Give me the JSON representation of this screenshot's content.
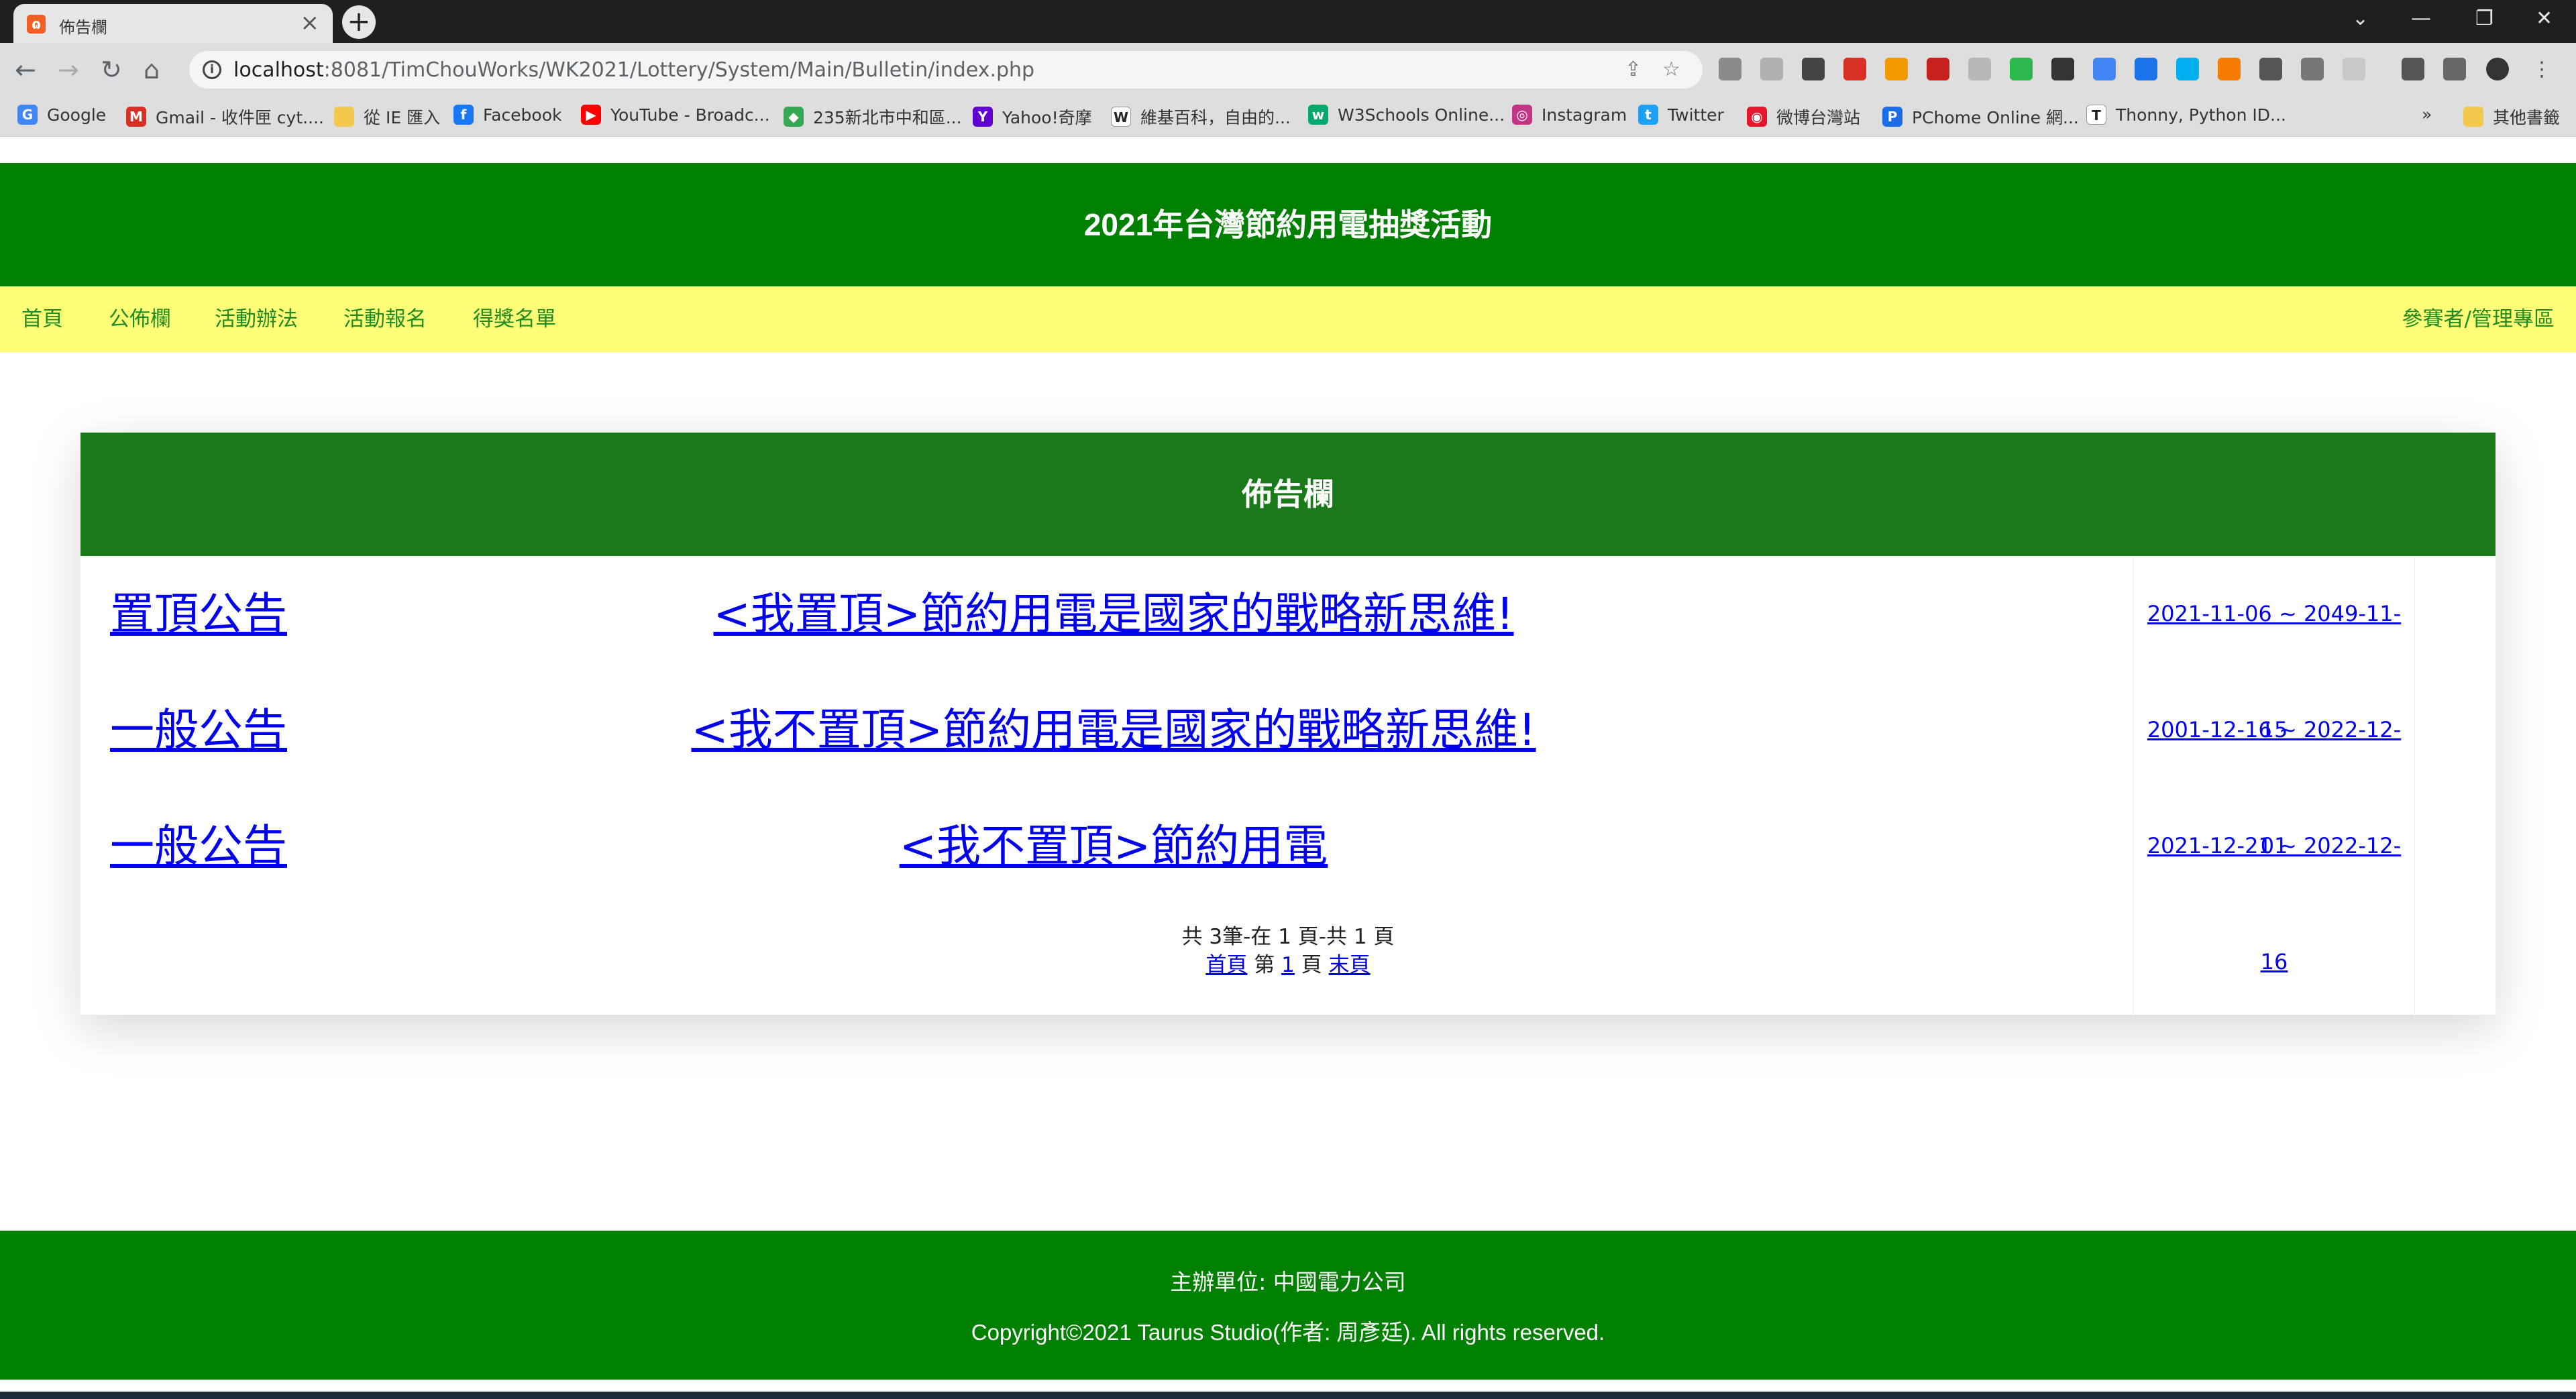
{
  "browser": {
    "tab_title": "佈告欄",
    "tab_favicon": "xampp-icon",
    "new_tab_label": "+",
    "window_controls": {
      "tab_search": "⌄",
      "minimize": "—",
      "restore": "❐",
      "close": "✕"
    },
    "url_host": "localhost",
    "url_rest": ":8081/TimChouWorks/WK2021/Lottery/System/Main/Bulletin/index.php",
    "bookmarks": [
      {
        "label": "Google",
        "icon": "google-icon",
        "color": "#4285f4",
        "glyph": "G"
      },
      {
        "label": "Gmail - 收件匣 cyt....",
        "icon": "gmail-icon",
        "color": "#d93025",
        "glyph": "M"
      },
      {
        "label": "從 IE 匯入",
        "icon": "folder-icon",
        "color": "#f2c94c",
        "glyph": ""
      },
      {
        "label": "Facebook",
        "icon": "facebook-icon",
        "color": "#1877f2",
        "glyph": "f"
      },
      {
        "label": "YouTube - Broadc...",
        "icon": "youtube-icon",
        "color": "#ff0000",
        "glyph": "▶"
      },
      {
        "label": "235新北市中和區...",
        "icon": "maps-icon",
        "color": "#34a853",
        "glyph": "◆"
      },
      {
        "label": "Yahoo!奇摩",
        "icon": "yahoo-icon",
        "color": "#6001d2",
        "glyph": "Y"
      },
      {
        "label": "維基百科，自由的...",
        "icon": "wikipedia-icon",
        "color": "#ffffff",
        "glyph": "W"
      },
      {
        "label": "W3Schools Online...",
        "icon": "w3schools-icon",
        "color": "#04aa6d",
        "glyph": "w"
      },
      {
        "label": "Instagram",
        "icon": "instagram-icon",
        "color": "#c13584",
        "glyph": "◎"
      },
      {
        "label": "Twitter",
        "icon": "twitter-icon",
        "color": "#1da1f2",
        "glyph": "t"
      },
      {
        "label": "微博台灣站",
        "icon": "weibo-icon",
        "color": "#e6162d",
        "glyph": "◉"
      },
      {
        "label": "PChome Online 網...",
        "icon": "pchome-icon",
        "color": "#1c6ee8",
        "glyph": "P"
      },
      {
        "label": "Thonny, Python ID...",
        "icon": "thonny-icon",
        "color": "#ffffff",
        "glyph": "T"
      }
    ],
    "bookmarks_overflow": "»",
    "other_bookmarks": "其他書籤"
  },
  "site": {
    "title": "2021年台灣節約用電抽獎活動",
    "nav": [
      "首頁",
      "公佈欄",
      "活動辦法",
      "活動報名",
      "得獎名單"
    ],
    "nav_right": "參賽者/管理專區"
  },
  "bulletin": {
    "heading": "佈告欄",
    "rows": [
      {
        "type": "置頂公告",
        "subject": "<我置頂>節約用電是國家的戰略新思維!",
        "dates": "2021-11-06 ~ 2049-11-15"
      },
      {
        "type": "一般公告",
        "subject": "<我不置頂>節約用電是國家的戰略新思維!",
        "dates": "2001-12-16 ~ 2022-12-01"
      },
      {
        "type": "一般公告",
        "subject": "<我不置頂>節約用電",
        "dates": "2021-12-21 ~ 2022-12-16"
      }
    ],
    "pager": {
      "summary_prefix": "共",
      "total": "3",
      "summary_mid1": "筆-在",
      "current": "1",
      "summary_mid2": "頁-共",
      "pages": "1",
      "summary_suffix": "頁",
      "first_label": "首頁",
      "page_prefix": "第",
      "page_num": "1",
      "page_suffix": "頁",
      "last_label": "末頁"
    }
  },
  "footer": {
    "organizer": "主辦單位: 中國電力公司",
    "copyright": "Copyright©2021 Taurus Studio(作者: 周彥廷). All rights reserved."
  },
  "colors": {
    "header_green": "#008000",
    "nav_yellow": "#ffff77",
    "nav_text": "#228b22",
    "panel_head_green": "#1a7a1a",
    "link_blue": "#0000ee"
  }
}
